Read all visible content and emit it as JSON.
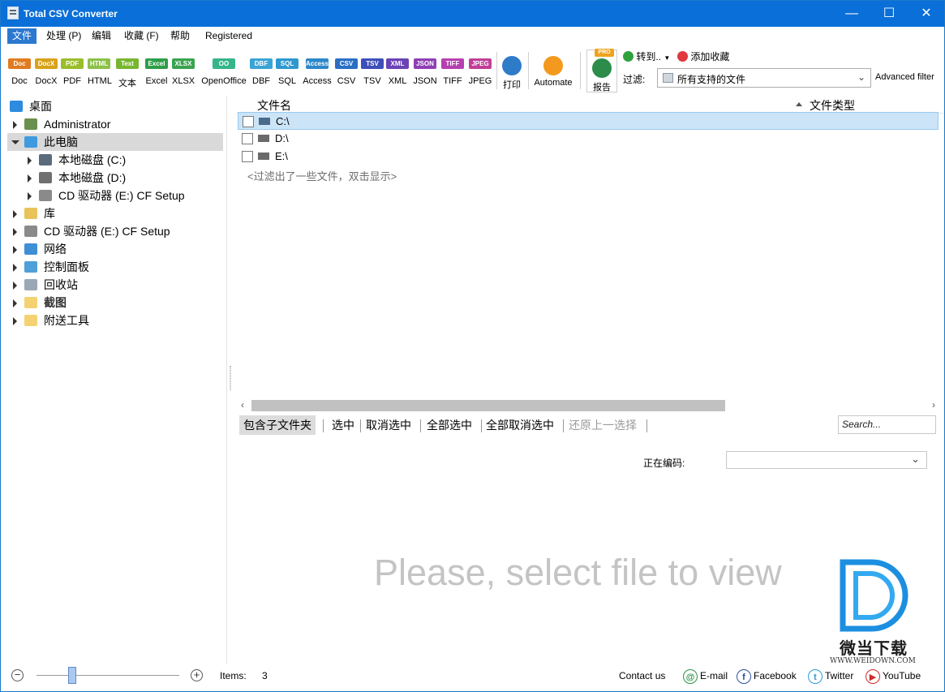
{
  "window": {
    "title": "Total CSV Converter",
    "minimize": "—",
    "maximize": "☐",
    "close": "✕"
  },
  "menu": [
    "文件",
    "处理 (P)",
    "编辑",
    "收藏 (F)",
    "帮助",
    "Registered"
  ],
  "toolbar": {
    "formats": [
      {
        "label": "Doc",
        "badge": "Doc",
        "color": "#e07b20"
      },
      {
        "label": "DocX",
        "badge": "DocX",
        "color": "#d9a21a"
      },
      {
        "label": "PDF",
        "badge": "PDF",
        "color": "#9bbd2c"
      },
      {
        "label": "HTML",
        "badge": "HTML",
        "color": "#8cc04a"
      },
      {
        "label": "文本",
        "badge": "Text",
        "color": "#78b62f"
      },
      {
        "label": "Excel",
        "badge": "Excel",
        "color": "#2e9e48"
      },
      {
        "label": "XLSX",
        "badge": "XLSX",
        "color": "#3aa34f"
      },
      {
        "label": "OpenOffice",
        "badge": "OO",
        "color": "#36b58a"
      },
      {
        "label": "DBF",
        "badge": "DBF",
        "color": "#3ba4d6"
      },
      {
        "label": "SQL",
        "badge": "SQL",
        "color": "#2f98d1"
      },
      {
        "label": "Access",
        "badge": "Access",
        "color": "#2d88c9"
      },
      {
        "label": "CSV",
        "badge": "CSV",
        "color": "#2b6fc4"
      },
      {
        "label": "TSV",
        "badge": "TSV",
        "color": "#3d4fb8"
      },
      {
        "label": "XML",
        "badge": "XML",
        "color": "#6a43b5"
      },
      {
        "label": "JSON",
        "badge": "JSON",
        "color": "#8e3fb5"
      },
      {
        "label": "TIFF",
        "badge": "TIFF",
        "color": "#b63fb0"
      },
      {
        "label": "JPEG",
        "badge": "JPEG",
        "color": "#c03f98"
      }
    ],
    "print_label": "打印",
    "automate_label": "Automate",
    "report_label": "报告",
    "report_badge": "PRO",
    "goto_label": "转到..",
    "favorite_label": "添加收藏",
    "filter_label": "过滤:",
    "filter_value": "所有支持的文件",
    "advanced_filter_label": "Advanced filter"
  },
  "tree": [
    {
      "label": "桌面",
      "icon": "desktop-icon",
      "indent": 0,
      "arrow": "none"
    },
    {
      "label": "Administrator",
      "icon": "user-icon",
      "indent": 1,
      "arrow": "right"
    },
    {
      "label": "此电脑",
      "icon": "computer-icon",
      "indent": 1,
      "arrow": "down",
      "selected": true
    },
    {
      "label": "本地磁盘 (C:)",
      "icon": "system-drive-icon",
      "indent": 2,
      "arrow": "right"
    },
    {
      "label": "本地磁盘 (D:)",
      "icon": "drive-icon",
      "indent": 2,
      "arrow": "right"
    },
    {
      "label": "CD 驱动器 (E:) CF Setup",
      "icon": "cd-drive-icon",
      "indent": 2,
      "arrow": "right"
    },
    {
      "label": "库",
      "icon": "library-icon",
      "indent": 1,
      "arrow": "right"
    },
    {
      "label": "CD 驱动器 (E:) CF Setup",
      "icon": "cd-drive-icon",
      "indent": 1,
      "arrow": "right"
    },
    {
      "label": "网络",
      "icon": "network-icon",
      "indent": 1,
      "arrow": "right"
    },
    {
      "label": "控制面板",
      "icon": "control-panel-icon",
      "indent": 1,
      "arrow": "right"
    },
    {
      "label": "回收站",
      "icon": "recycle-bin-icon",
      "indent": 1,
      "arrow": "right"
    },
    {
      "label": "截图",
      "icon": "folder-icon",
      "indent": 1,
      "arrow": "right",
      "bold": true
    },
    {
      "label": "附送工具",
      "icon": "folder-icon",
      "indent": 1,
      "arrow": "right"
    }
  ],
  "filelist": {
    "col_name": "文件名",
    "col_type": "文件类型",
    "rows": [
      {
        "name": "C:\\",
        "selected": true
      },
      {
        "name": "D:\\",
        "selected": false
      },
      {
        "name": "E:\\",
        "selected": false
      }
    ],
    "hint": "<过滤出了一些文件，双击显示>"
  },
  "actions": {
    "include_subfolders": "包含子文件夹",
    "select": "选中",
    "unselect": "取消选中",
    "select_all": "全部选中",
    "unselect_all": "全部取消选中",
    "restore": "还原上一选择",
    "search_placeholder": "Search..."
  },
  "preview": {
    "encoding_label": "正在编码:",
    "encoding_value": "",
    "placeholder": "Please, select file to view"
  },
  "watermark": {
    "cn": "微当下载",
    "url": "WWW.WEIDOWN.COM"
  },
  "status": {
    "items_label": "Items:",
    "items_count": "3",
    "contact": "Contact us",
    "email": "E-mail",
    "facebook": "Facebook",
    "twitter": "Twitter",
    "youtube": "YouTube",
    "zoom_level": 0.25
  }
}
